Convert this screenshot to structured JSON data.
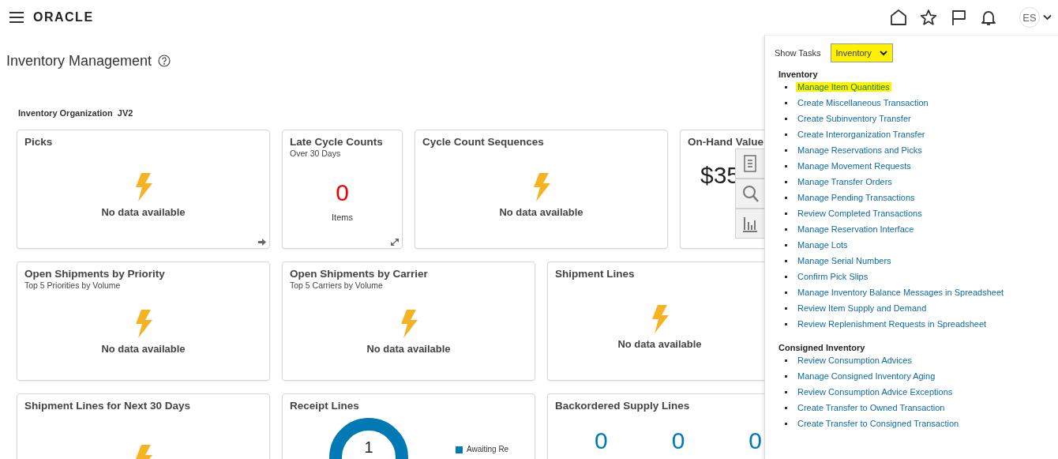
{
  "header": {
    "brand": "ORACLE",
    "user_initials": "ES"
  },
  "page": {
    "title": "Inventory Management"
  },
  "organization": {
    "label": "Inventory Organization",
    "value": "JV2"
  },
  "rows": [
    {
      "cards": [
        {
          "kind": "empty",
          "title": "Picks",
          "message": "No data available",
          "navigable": true
        },
        {
          "kind": "metric",
          "title": "Late Cycle Counts",
          "subtitle": "Over 30 Days",
          "value": "0",
          "unit": "Items",
          "alert": true,
          "expandable": true
        },
        {
          "kind": "empty",
          "title": "Cycle Count Sequences",
          "message": "No data available"
        },
        {
          "kind": "value",
          "title": "On-Hand Value",
          "value": "$35"
        }
      ]
    },
    {
      "cards": [
        {
          "kind": "empty",
          "title": "Open Shipments by Priority",
          "subtitle": "Top 5 Priorities by Volume",
          "message": "No data available"
        },
        {
          "kind": "empty",
          "title": "Open Shipments by Carrier",
          "subtitle": "Top 5 Carriers by Volume",
          "message": "No data available"
        },
        {
          "kind": "empty",
          "title": "Shipment Lines",
          "message": "No data available"
        }
      ]
    },
    {
      "cards": [
        {
          "kind": "empty",
          "title": "Shipment Lines for Next 30 Days"
        },
        {
          "kind": "donut",
          "title": "Receipt Lines",
          "center_value": "1",
          "legend": [
            {
              "label": "Awaiting Re",
              "color": "#0079b5"
            }
          ]
        },
        {
          "kind": "metrics",
          "title": "Backordered Supply Lines",
          "values": [
            "0",
            "0",
            "0"
          ]
        }
      ]
    }
  ],
  "task_panel": {
    "label": "Show Tasks",
    "filter": {
      "value": "Inventory",
      "highlighted": true
    },
    "groups": [
      {
        "heading": "Inventory",
        "tasks": [
          {
            "label": "Manage Item Quantities",
            "highlighted": true
          },
          {
            "label": "Create Miscellaneous Transaction",
            "highlighted": false
          },
          {
            "label": "Create Subinventory Transfer",
            "highlighted": false
          },
          {
            "label": "Create Interorganization Transfer",
            "highlighted": false
          },
          {
            "label": "Manage Reservations and Picks",
            "highlighted": false
          },
          {
            "label": "Manage Movement Requests",
            "highlighted": false
          },
          {
            "label": "Manage Transfer Orders",
            "highlighted": false
          },
          {
            "label": "Manage Pending Transactions",
            "highlighted": false
          },
          {
            "label": "Review Completed Transactions",
            "highlighted": false
          },
          {
            "label": "Manage Reservation Interface",
            "highlighted": false
          },
          {
            "label": "Manage Lots",
            "highlighted": false
          },
          {
            "label": "Manage Serial Numbers",
            "highlighted": false
          },
          {
            "label": "Confirm Pick Slips",
            "highlighted": false
          },
          {
            "label": "Manage Inventory Balance Messages in Spreadsheet",
            "highlighted": false
          },
          {
            "label": "Review Item Supply and Demand",
            "highlighted": false
          },
          {
            "label": "Review Replenishment Requests in Spreadsheet",
            "highlighted": false
          }
        ]
      },
      {
        "heading": "Consigned Inventory",
        "tasks": [
          {
            "label": "Review Consumption Advices",
            "highlighted": false
          },
          {
            "label": "Manage Consigned Inventory Aging",
            "highlighted": false
          },
          {
            "label": "Review Consumption Advice Exceptions",
            "highlighted": false
          },
          {
            "label": "Create Transfer to Owned Transaction",
            "highlighted": false
          },
          {
            "label": "Create Transfer to Consigned Transaction",
            "highlighted": false
          }
        ]
      }
    ]
  }
}
